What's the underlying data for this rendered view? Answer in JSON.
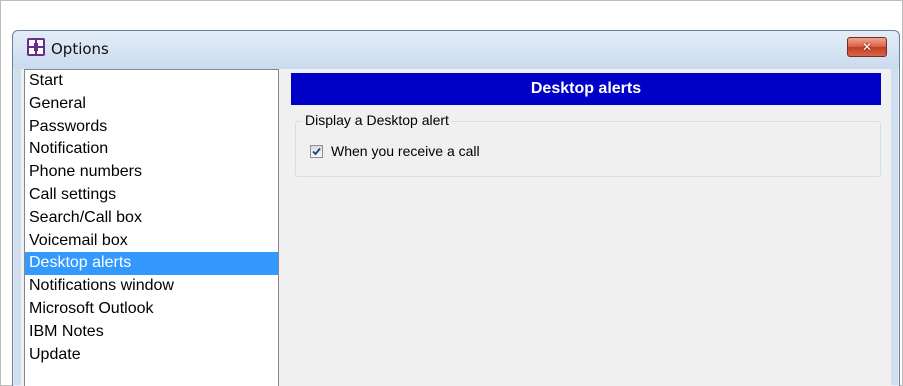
{
  "window": {
    "title": "Options",
    "close_glyph": "✕",
    "app_icon": "options-app-icon"
  },
  "colors": {
    "header_background": "#0000C8",
    "selection_background": "#3399FF",
    "close_button": "#C03D24"
  },
  "sidebar": {
    "items": [
      {
        "label": "Start",
        "selected": false
      },
      {
        "label": "General",
        "selected": false
      },
      {
        "label": "Passwords",
        "selected": false
      },
      {
        "label": "Notification",
        "selected": false
      },
      {
        "label": "Phone numbers",
        "selected": false
      },
      {
        "label": "Call settings",
        "selected": false
      },
      {
        "label": "Search/Call box",
        "selected": false
      },
      {
        "label": "Voicemail box",
        "selected": false
      },
      {
        "label": "Desktop alerts",
        "selected": true
      },
      {
        "label": "Notifications window",
        "selected": false
      },
      {
        "label": "Microsoft Outlook",
        "selected": false
      },
      {
        "label": "IBM Notes",
        "selected": false
      },
      {
        "label": "Update",
        "selected": false
      }
    ]
  },
  "main": {
    "header": "Desktop alerts",
    "group": {
      "legend": "Display a Desktop alert",
      "checkbox": {
        "label": "When you receive a call",
        "checked": true
      }
    }
  }
}
